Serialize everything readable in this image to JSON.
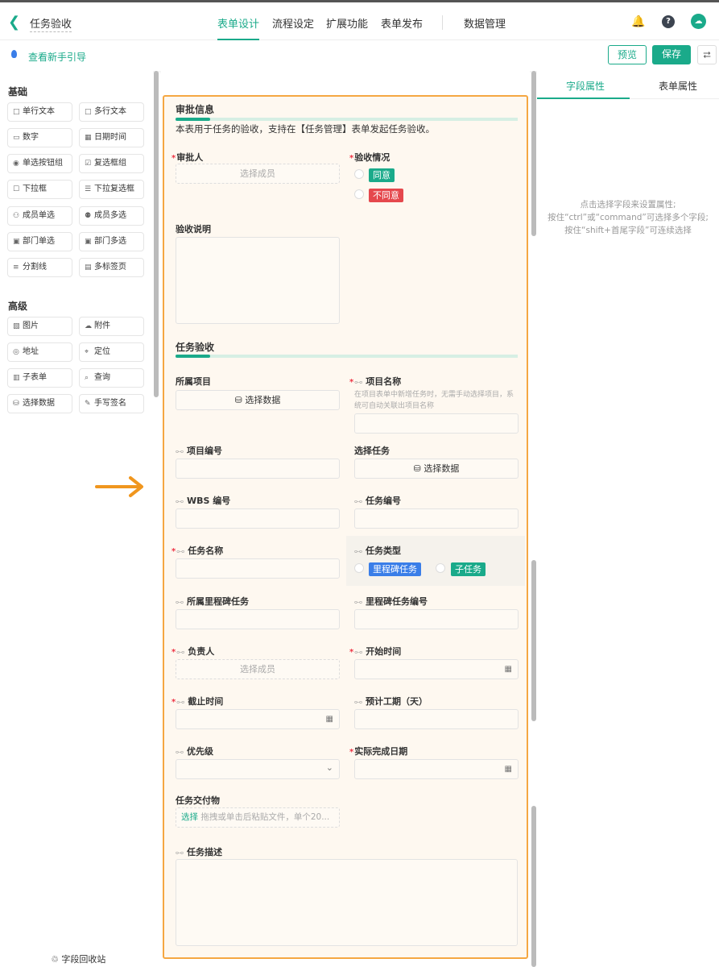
{
  "app": {
    "title": "任务验收",
    "back_icon": "chevron-left-icon"
  },
  "nav": {
    "tabs": [
      "表单设计",
      "流程设定",
      "扩展功能",
      "表单发布",
      "数据管理"
    ],
    "active": 0
  },
  "header_icons": [
    "bell-icon",
    "help-icon",
    "cloud-icon"
  ],
  "toolbar": {
    "guide": "查看新手引导",
    "preview": "预览",
    "save": "保存",
    "share_icon": "share-icon"
  },
  "colors": {
    "accent": "#1aaa8a",
    "form_border": "#f5a742",
    "agree": "#1aaa8a",
    "disagree": "#e5484d",
    "milestone": "#3a7ee8"
  },
  "left": {
    "basic_title": "基础",
    "basic": [
      "单行文本",
      "多行文本",
      "数字",
      "日期时间",
      "单选按钮组",
      "复选框组",
      "下拉框",
      "下拉复选框",
      "成员单选",
      "成员多选",
      "部门单选",
      "部门多选",
      "分割线",
      "多标签页"
    ],
    "advanced_title": "高级",
    "advanced": [
      "图片",
      "附件",
      "地址",
      "定位",
      "子表单",
      "查询",
      "选择数据",
      "手写签名"
    ],
    "recycle": "字段回收站"
  },
  "form": {
    "sec1": {
      "title": "审批信息",
      "desc": "本表用于任务的验收，支持在【任务管理】表单发起任务验收。"
    },
    "approver": {
      "label": "审批人",
      "placeholder": "选择成员"
    },
    "acceptance": {
      "label": "验收情况",
      "options": [
        "同意",
        "不同意"
      ]
    },
    "acceptance_note": {
      "label": "验收说明"
    },
    "sec2": {
      "title": "任务验收"
    },
    "project": {
      "label": "所属项目",
      "button": "选择数据"
    },
    "project_name": {
      "label": "项目名称",
      "help": "在项目表单中新增任务时，无需手动选择项目，系统可自动关联出项目名称"
    },
    "project_no": {
      "label": "项目编号"
    },
    "select_task": {
      "label": "选择任务",
      "button": "选择数据"
    },
    "wbs": {
      "label": "WBS 编号"
    },
    "task_no": {
      "label": "任务编号"
    },
    "task_name": {
      "label": "任务名称"
    },
    "task_type": {
      "label": "任务类型",
      "options": [
        "里程碑任务",
        "子任务"
      ]
    },
    "milestone": {
      "label": "所属里程碑任务"
    },
    "milestone_no": {
      "label": "里程碑任务编号"
    },
    "owner": {
      "label": "负责人",
      "placeholder": "选择成员"
    },
    "start": {
      "label": "开始时间"
    },
    "deadline": {
      "label": "截止时间"
    },
    "duration": {
      "label": "预计工期（天）"
    },
    "priority": {
      "label": "优先级"
    },
    "actual_date": {
      "label": "实际完成日期"
    },
    "deliverable": {
      "label": "任务交付物",
      "select": "选择",
      "placeholder": "拖拽或单击后粘贴文件，单个20..."
    },
    "description": {
      "label": "任务描述"
    }
  },
  "right": {
    "tabs": [
      "字段属性",
      "表单属性"
    ],
    "hint": [
      "点击选择字段来设置属性;",
      "按住“ctrl”或“command”可选择多个字段;",
      "按住“shift+首尾字段”可连续选择"
    ]
  }
}
